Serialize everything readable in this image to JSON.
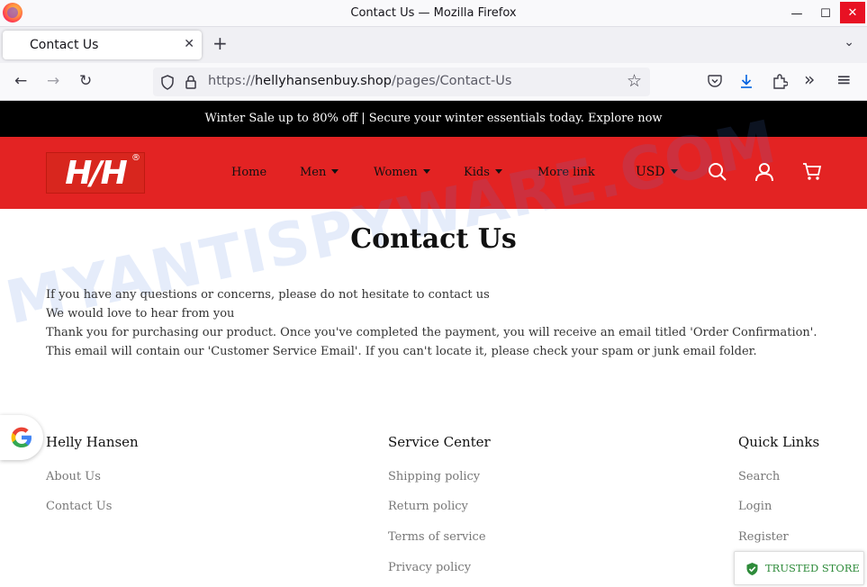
{
  "window": {
    "title": "Contact Us — Mozilla Firefox",
    "minimize": "—",
    "maximize": "☐",
    "close": "✕"
  },
  "tabs": [
    {
      "label": "Contact Us",
      "close": "✕"
    }
  ],
  "tabstrip": {
    "new_tab": "+",
    "list_tabs": "⌄"
  },
  "nav": {
    "back": "←",
    "forward": "→",
    "reload": "↻",
    "url_scheme": "https://",
    "url_host": "hellyhansenbuy.shop",
    "url_path": "/pages/Contact-Us",
    "bookmark": "☆",
    "overflow": "»",
    "menu": "≡"
  },
  "site": {
    "announcement": "Winter Sale up to 80% off | Secure your winter essentials today. Explore now",
    "logo_text": "H/H",
    "logo_reg": "®",
    "menu": [
      {
        "label": "Home",
        "dropdown": false
      },
      {
        "label": "Men",
        "dropdown": true
      },
      {
        "label": "Women",
        "dropdown": true
      },
      {
        "label": "Kids",
        "dropdown": true
      },
      {
        "label": "More link",
        "dropdown": false
      }
    ],
    "currency": "USD",
    "brand_color": "#e32323"
  },
  "watermark": "MYANTISPYWARE.COM",
  "content": {
    "title": "Contact Us",
    "paragraphs": [
      "If you have any questions or concerns, please do not hesitate to contact us",
      "We would love to hear from you",
      "Thank you for purchasing our product. Once you've completed the payment, you will receive an email titled 'Order Confirmation'. This email will contain our 'Customer Service Email'. If you can't locate it, please check your spam or junk email folder."
    ]
  },
  "footer": {
    "columns": [
      {
        "heading": "Helly Hansen",
        "links": [
          "About Us",
          "Contact Us"
        ]
      },
      {
        "heading": "Service Center",
        "links": [
          "Shipping policy",
          "Return policy",
          "Terms of service",
          "Privacy policy"
        ]
      },
      {
        "heading": "Quick Links",
        "links": [
          "Search",
          "Login",
          "Register"
        ]
      }
    ]
  },
  "trusted_store": {
    "label": "TRUSTED STORE",
    "color": "#2e8b3a"
  }
}
